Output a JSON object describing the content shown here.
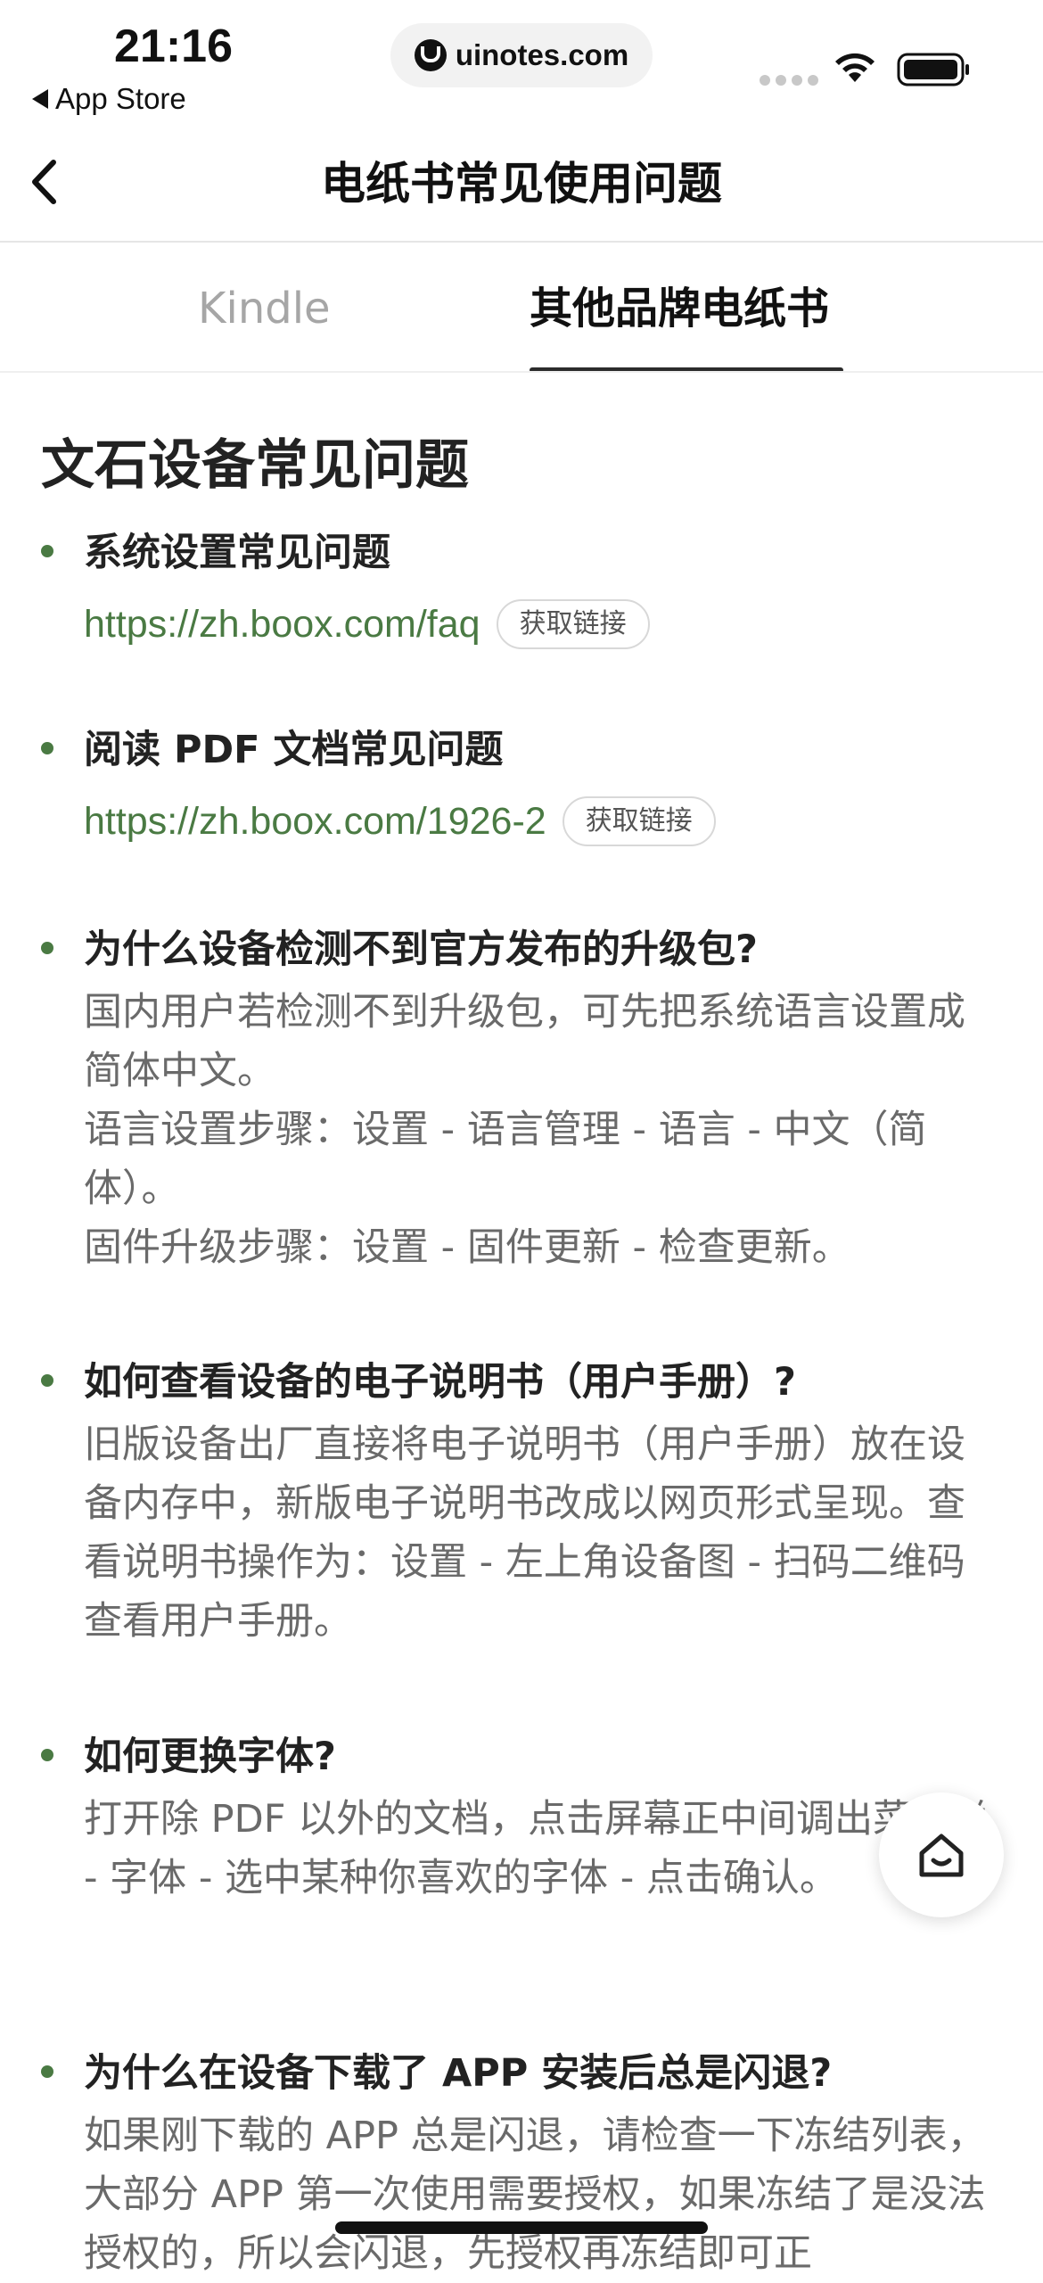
{
  "status_bar": {
    "time": "21:16",
    "back_app": "App Store",
    "url": "uinotes.com"
  },
  "nav": {
    "title": "电纸书常见使用问题"
  },
  "tabs": [
    {
      "label": "Kindle",
      "active": false
    },
    {
      "label": "其他品牌电纸书",
      "active": true
    }
  ],
  "section": {
    "title": "文石设备常见问题"
  },
  "faq": [
    {
      "question": "系统设置常见问题",
      "link": "https://zh.boox.com/faq",
      "button": "获取链接"
    },
    {
      "question": "阅读 PDF 文档常见问题",
      "link": "https://zh.boox.com/1926-2",
      "button": "获取链接"
    },
    {
      "question": "为什么设备检测不到官方发布的升级包?",
      "answer": [
        "国内用户若检测不到升级包，可先把系统语言设置成简体中文。",
        "语言设置步骤：设置 - 语言管理 - 语言 - 中文（简体）。",
        "固件升级步骤：设置 - 固件更新 - 检查更新。"
      ]
    },
    {
      "question": "如何查看设备的电子说明书（用户手册）?",
      "answer": [
        "旧版设备出厂直接将电子说明书（用户手册）放在设备内存中，新版电子说明书改成以网页形式呈现。查看说明书操作为：设置 - 左上角设备图 - 扫码二维码查看用户手册。"
      ]
    },
    {
      "question": "如何更换字体?",
      "answer": [
        "打开除 PDF 以外的文档，点击屏幕正中间调出菜单栏 - 字体 - 选中某种你喜欢的字体 - 点击确认。"
      ]
    },
    {
      "question": "为什么在设备下载了 APP 安装后总是闪退?",
      "answer": [
        "如果刚下载的 APP 总是闪退，请检查一下冻结列表，大部分 APP 第一次使用需要授权，如果冻结了是没法授权的，所以会闪退，先授权再冻结即可正"
      ]
    }
  ],
  "colors": {
    "accent_green": "#4a7a43",
    "text_dark": "#222222",
    "text_muted": "#6a6a6a",
    "tab_inactive": "#a6a6a6"
  },
  "icons": {
    "back": "chevron-left-icon",
    "home": "home-icon",
    "wifi": "wifi-icon",
    "battery": "battery-icon"
  }
}
